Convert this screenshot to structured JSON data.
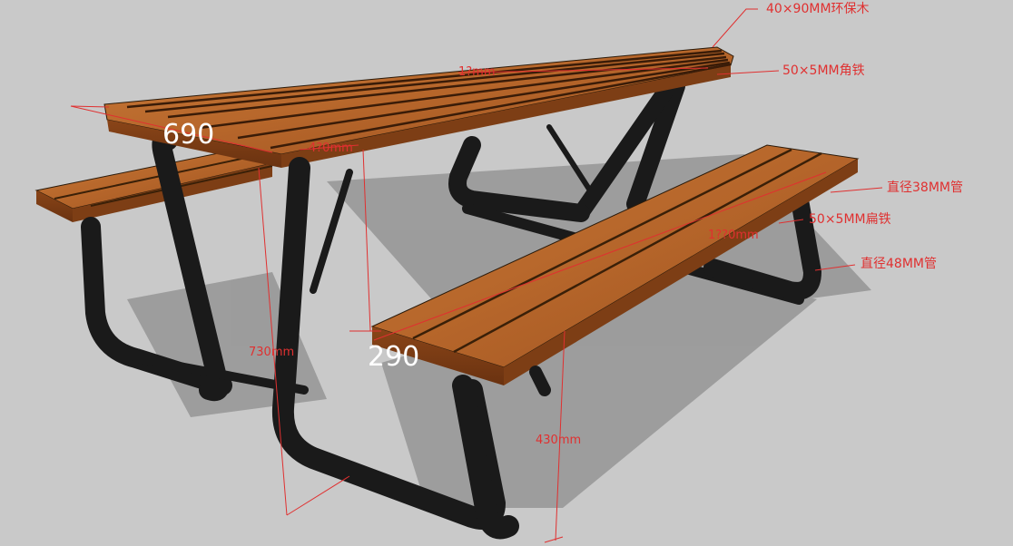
{
  "labels": {
    "callout_wood": "40×90MM环保木",
    "callout_angle": "50×5MM角铁",
    "callout_tube38": "直径38MM管",
    "callout_flat": "50×5MM扁铁",
    "callout_tube48": "直径48MM管"
  },
  "dimensions": {
    "tabletop_depth": "690",
    "bench_depth": "290",
    "table_height": "730mm",
    "bench_height": "430mm",
    "top_length": "1?mm",
    "top_gap": "4?0mm",
    "bench_length": "1??0mm"
  },
  "colors": {
    "background": "#c9c9c9",
    "wood": "#b8692c",
    "frame": "#1a1a1a",
    "annotation": "#e03030"
  }
}
